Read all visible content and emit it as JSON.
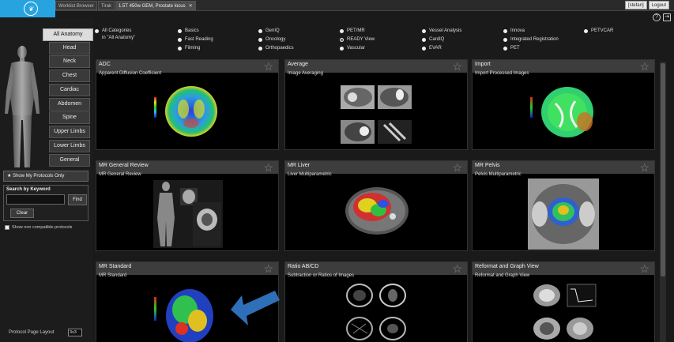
{
  "tabs": [
    {
      "label": "Worklist Browser",
      "active": false
    },
    {
      "label": "Tirak",
      "active": false
    },
    {
      "label": "1.5T 450w GEM, Prostate locus",
      "active": true,
      "closable": true
    }
  ],
  "user": {
    "name": "[stefan]",
    "logout": "Logout"
  },
  "corner_icons": [
    "help-icon",
    "exit-icon"
  ],
  "regions": [
    {
      "label": "All Anatomy",
      "active": true
    },
    {
      "label": "Head"
    },
    {
      "label": "Neck"
    },
    {
      "label": "Chest"
    },
    {
      "label": "Cardiac"
    },
    {
      "label": "Abdomen"
    },
    {
      "label": "Spine"
    },
    {
      "label": "Upper Limbs"
    },
    {
      "label": "Lower Limbs"
    },
    {
      "label": "General"
    }
  ],
  "show_my_protocols": "Show My Protocols Only",
  "search": {
    "label": "Search by Keyword",
    "value": "",
    "find": "Find",
    "clear": "Clear"
  },
  "compat_label": "Show non compatible protocols",
  "layout_label": "Protocol Page Layout",
  "layout_value": "3x3",
  "categories": [
    {
      "label": "All Categories",
      "sub": "in \"All Anatomy\"",
      "selected": false
    },
    {
      "label": "Basics"
    },
    {
      "label": "Fast Reading"
    },
    {
      "label": "Filming"
    },
    {
      "label": "GenIQ"
    },
    {
      "label": "Oncology"
    },
    {
      "label": "Orthopaedics"
    },
    {
      "label": "PET/MR"
    },
    {
      "label": "READY View",
      "selected": true
    },
    {
      "label": "Vascular"
    },
    {
      "label": "Vessel Analysis"
    },
    {
      "label": "CardIQ"
    },
    {
      "label": "EVAR"
    },
    {
      "label": "Innova"
    },
    {
      "label": "Integrated Registration"
    },
    {
      "label": "PET"
    },
    {
      "label": "PETVCAR"
    }
  ],
  "protocols": [
    {
      "title": "ADC",
      "desc": "Apparent Diffusion Coefficient",
      "thumb": "adc-map"
    },
    {
      "title": "Average",
      "desc": "Image Averaging",
      "thumb": "average-grid"
    },
    {
      "title": "Import",
      "desc": "Import Processed Images",
      "thumb": "import-map"
    },
    {
      "title": "MR General Review",
      "desc": "MR General Review",
      "thumb": "body-review"
    },
    {
      "title": "MR Liver",
      "desc": "Liver Multiparametric",
      "thumb": "liver-map"
    },
    {
      "title": "MR Pelvis",
      "desc": "Pelvis Multiparametric",
      "thumb": "pelvis-map"
    },
    {
      "title": "MR Standard",
      "desc": "MR Standard",
      "thumb": "brain-color"
    },
    {
      "title": "Ratio AB/CD",
      "desc": "Subtraction or Ratios of Images",
      "thumb": "ratio-grid"
    },
    {
      "title": "Reformat and Graph View",
      "desc": "Reformat and Graph View",
      "thumb": "reformat-grid"
    }
  ],
  "colors": {
    "accent": "#27a3e0",
    "arrow": "#2f6fb8"
  }
}
